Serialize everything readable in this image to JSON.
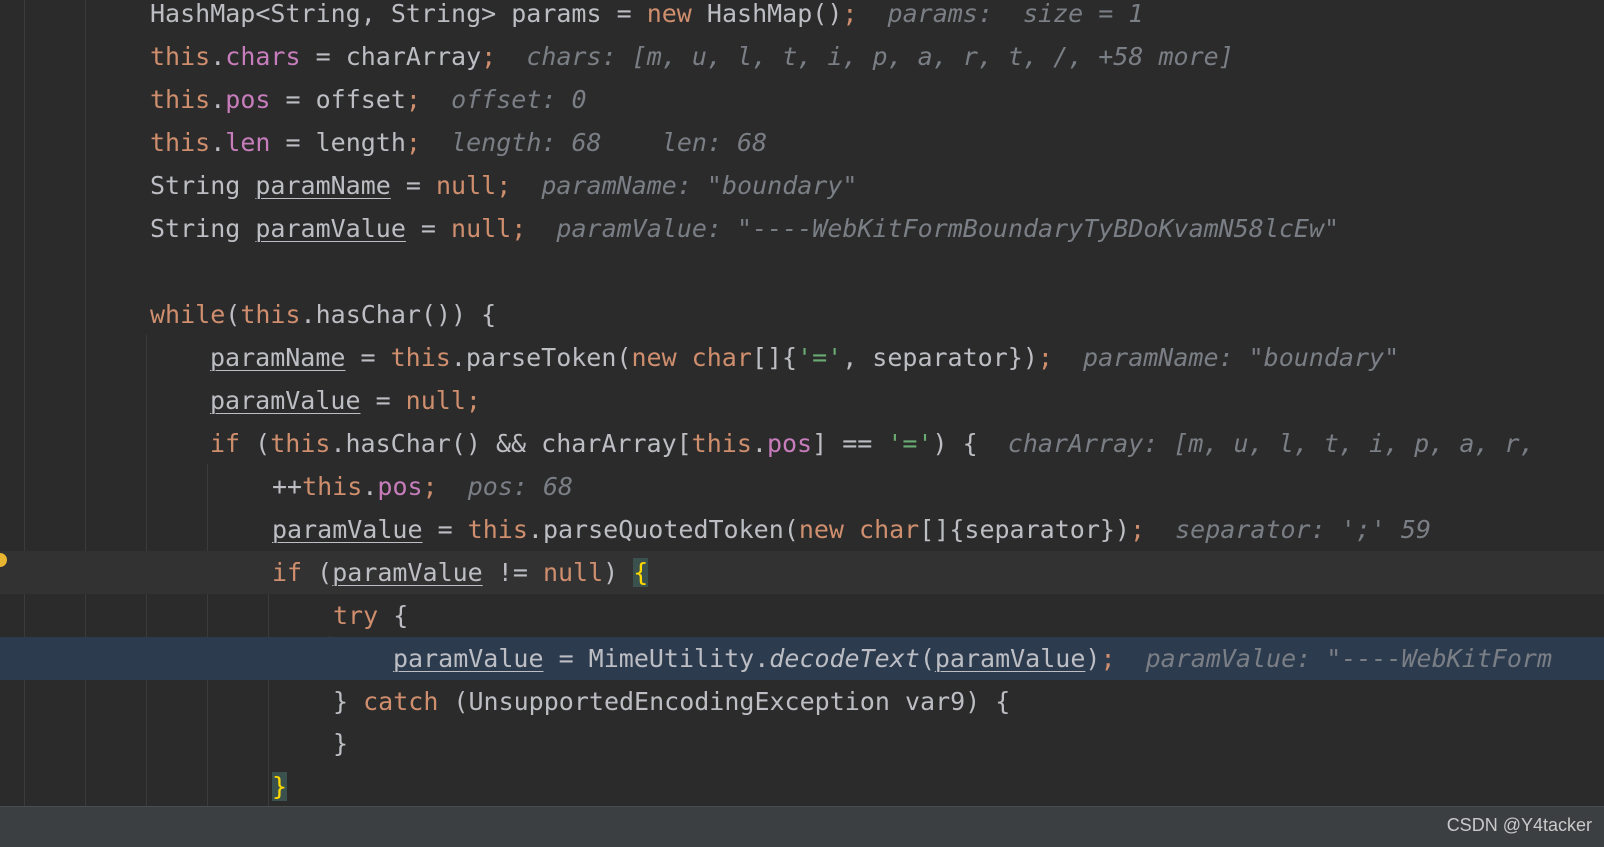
{
  "editor": {
    "lines": [
      {
        "segments": [
          {
            "t": "HashMap<String, String> params = "
          },
          {
            "t": "new",
            "c": "kw"
          },
          {
            "t": " HashMap()"
          },
          {
            "t": ";",
            "c": "kw"
          },
          {
            "t": "  params:  size = 1",
            "c": "hint"
          }
        ]
      },
      {
        "segments": [
          {
            "t": "this",
            "c": "kw"
          },
          {
            "t": "."
          },
          {
            "t": "chars",
            "c": "fld"
          },
          {
            "t": " = charArray"
          },
          {
            "t": ";",
            "c": "kw"
          },
          {
            "t": "  chars: [m, u, l, t, i, p, a, r, t, /, +58 more]",
            "c": "hint"
          }
        ]
      },
      {
        "segments": [
          {
            "t": "this",
            "c": "kw"
          },
          {
            "t": "."
          },
          {
            "t": "pos",
            "c": "fld"
          },
          {
            "t": " = offset"
          },
          {
            "t": ";",
            "c": "kw"
          },
          {
            "t": "  offset: 0",
            "c": "hint"
          }
        ]
      },
      {
        "segments": [
          {
            "t": "this",
            "c": "kw"
          },
          {
            "t": "."
          },
          {
            "t": "len",
            "c": "fld"
          },
          {
            "t": " = length"
          },
          {
            "t": ";",
            "c": "kw"
          },
          {
            "t": "  length: 68    len: 68",
            "c": "hint"
          }
        ]
      },
      {
        "segments": [
          {
            "t": "String "
          },
          {
            "t": "paramName",
            "c": "var"
          },
          {
            "t": " = "
          },
          {
            "t": "null",
            "c": "kw"
          },
          {
            "t": ";",
            "c": "kw"
          },
          {
            "t": "  paramName: \"boundary\"",
            "c": "hint"
          }
        ]
      },
      {
        "segments": [
          {
            "t": "String "
          },
          {
            "t": "paramValue",
            "c": "var"
          },
          {
            "t": " = "
          },
          {
            "t": "null",
            "c": "kw"
          },
          {
            "t": ";",
            "c": "kw"
          },
          {
            "t": "  paramValue: \"----WebKitFormBoundaryTyBDoKvamN58lcEw\"",
            "c": "hint"
          }
        ]
      },
      {
        "segments": []
      },
      {
        "segments": [
          {
            "t": "while",
            "c": "kw"
          },
          {
            "t": "("
          },
          {
            "t": "this",
            "c": "kw"
          },
          {
            "t": ".hasChar()) {"
          }
        ]
      },
      {
        "segments": [
          {
            "t": "paramName",
            "c": "var"
          },
          {
            "t": " = "
          },
          {
            "t": "this",
            "c": "kw"
          },
          {
            "t": ".parseToken("
          },
          {
            "t": "new char",
            "c": "kw"
          },
          {
            "t": "[]{"
          },
          {
            "t": "'='",
            "c": "str"
          },
          {
            "t": ", separator})"
          },
          {
            "t": ";",
            "c": "kw"
          },
          {
            "t": "  paramName: \"boundary\"",
            "c": "hint"
          }
        ]
      },
      {
        "segments": [
          {
            "t": "paramValue",
            "c": "var"
          },
          {
            "t": " = "
          },
          {
            "t": "null",
            "c": "kw"
          },
          {
            "t": ";",
            "c": "kw"
          }
        ]
      },
      {
        "segments": [
          {
            "t": "if",
            "c": "kw"
          },
          {
            "t": " ("
          },
          {
            "t": "this",
            "c": "kw"
          },
          {
            "t": ".hasChar() && charArray["
          },
          {
            "t": "this",
            "c": "kw"
          },
          {
            "t": "."
          },
          {
            "t": "pos",
            "c": "fld"
          },
          {
            "t": "] == "
          },
          {
            "t": "'='",
            "c": "str"
          },
          {
            "t": ") {"
          },
          {
            "t": "  charArray: [m, u, l, t, i, p, a, r,",
            "c": "hint"
          }
        ]
      },
      {
        "segments": [
          {
            "t": "++"
          },
          {
            "t": "this",
            "c": "kw"
          },
          {
            "t": "."
          },
          {
            "t": "pos",
            "c": "fld"
          },
          {
            "t": ";",
            "c": "kw"
          },
          {
            "t": "  pos: 68",
            "c": "hint"
          }
        ]
      },
      {
        "segments": [
          {
            "t": "paramValue",
            "c": "var"
          },
          {
            "t": " = "
          },
          {
            "t": "this",
            "c": "kw"
          },
          {
            "t": ".parseQuotedToken("
          },
          {
            "t": "new char",
            "c": "kw"
          },
          {
            "t": "[]{separator})"
          },
          {
            "t": ";",
            "c": "kw"
          },
          {
            "t": "  separator: ';' 59",
            "c": "hint"
          }
        ]
      },
      {
        "segments": [
          {
            "t": "if",
            "c": "kw"
          },
          {
            "t": " ("
          },
          {
            "t": "paramValue",
            "c": "var"
          },
          {
            "t": " != "
          },
          {
            "t": "null",
            "c": "kw"
          },
          {
            "t": ") "
          },
          {
            "t": "{",
            "c": "brace-match"
          }
        ]
      },
      {
        "segments": [
          {
            "t": "try",
            "c": "kw"
          },
          {
            "t": " {"
          }
        ]
      },
      {
        "segments": [
          {
            "t": "paramValue",
            "c": "var"
          },
          {
            "t": " = MimeUtility."
          },
          {
            "t": "decodeText",
            "c": "it"
          },
          {
            "t": "("
          },
          {
            "t": "paramValue",
            "c": "var"
          },
          {
            "t": ")"
          },
          {
            "t": ";",
            "c": "kw"
          },
          {
            "t": "  paramValue: \"----WebKitForm",
            "c": "hint"
          }
        ]
      },
      {
        "segments": [
          {
            "t": "} "
          },
          {
            "t": "catch",
            "c": "kw"
          },
          {
            "t": " (UnsupportedEncodingException var9) {"
          }
        ]
      },
      {
        "segments": [
          {
            "t": "}"
          }
        ]
      },
      {
        "segments": [
          {
            "t": "}",
            "c": "brace-match"
          }
        ]
      }
    ]
  },
  "footer": {
    "watermark": "CSDN @Y4tacker"
  }
}
